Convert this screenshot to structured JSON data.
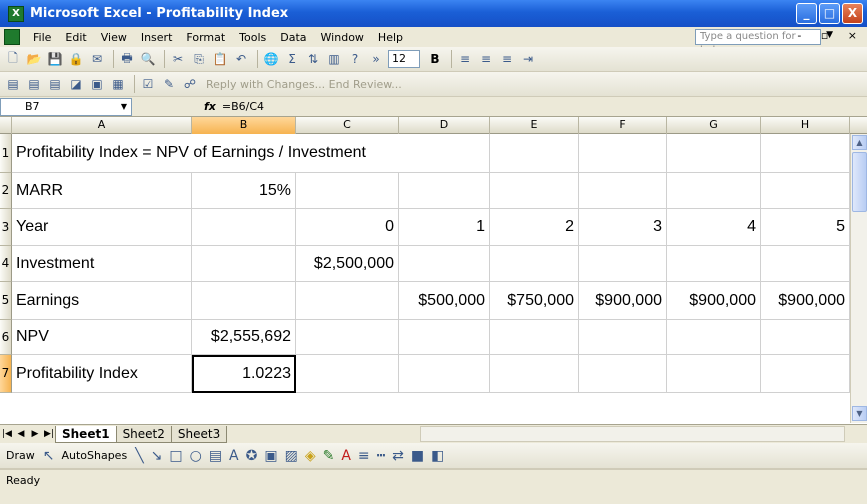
{
  "window": {
    "title": "Microsoft Excel - Profitability Index",
    "app_icon": "excel-icon",
    "controls": [
      "_",
      "□",
      "X"
    ]
  },
  "menubar": {
    "items": [
      "File",
      "Edit",
      "View",
      "Insert",
      "Format",
      "Tools",
      "Data",
      "Window",
      "Help"
    ],
    "help_placeholder": "Type a question for help",
    "doc_controls": "- ▫ ×"
  },
  "toolbar": {
    "font_size": "12",
    "review_text": "Reply with Changes... End Review...",
    "align_icon_names": [
      "bold",
      "align-left",
      "align-center",
      "align-right",
      "indent"
    ]
  },
  "formula_bar": {
    "name_box": "B7",
    "fx_label": "fx",
    "formula": "=B6/C4"
  },
  "sheet": {
    "columns": [
      "A",
      "B",
      "C",
      "D",
      "E",
      "F",
      "G",
      "H"
    ],
    "selected_column": "B",
    "selected_row": "7",
    "active_cell": "B7",
    "rows": [
      {
        "num": "1",
        "cells": {
          "A": "Profitability Index = NPV of Earnings / Investment"
        }
      },
      {
        "num": "2",
        "cells": {
          "A": "MARR",
          "B": "15%"
        }
      },
      {
        "num": "3",
        "cells": {
          "A": "Year",
          "C": "0",
          "D": "1",
          "E": "2",
          "F": "3",
          "G": "4",
          "H": "5"
        }
      },
      {
        "num": "4",
        "cells": {
          "A": "Investment",
          "C": "$2,500,000"
        }
      },
      {
        "num": "5",
        "cells": {
          "A": "Earnings",
          "D": "$500,000",
          "E": "$750,000",
          "F": "$900,000",
          "G": "$900,000",
          "H": "$900,000"
        }
      },
      {
        "num": "6",
        "cells": {
          "A": "NPV",
          "B": "$2,555,692"
        }
      },
      {
        "num": "7",
        "cells": {
          "A": "Profitability Index",
          "B": "1.0223"
        }
      }
    ]
  },
  "sheet_tabs": [
    "Sheet1",
    "Sheet2",
    "Sheet3"
  ],
  "active_sheet": "Sheet1",
  "drawbar": {
    "draw_label": "Draw",
    "autoshapes_label": "AutoShapes"
  },
  "status": {
    "text": "Ready"
  }
}
